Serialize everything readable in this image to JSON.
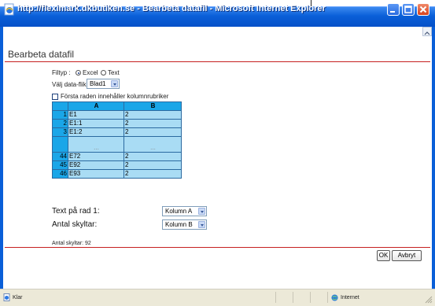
{
  "window": {
    "title": "http://fleximark.dkbutiken.se - Bearbeta datafil - Microsoft Internet Explorer"
  },
  "page": {
    "title": "Bearbeta datafil",
    "filetype_label": "Filtyp :",
    "filetype_options": [
      "Excel",
      "Text"
    ],
    "filetype_selected": "Excel",
    "sheet_label": "Välj data-flik:",
    "sheet_value": "Blad1",
    "first_row_header_label": "Första raden innehåller kolumnrubriker",
    "first_row_header_checked": false
  },
  "table": {
    "columns": [
      "A",
      "B"
    ],
    "rows": [
      {
        "num": "1",
        "a": "E1",
        "b": "2"
      },
      {
        "num": "2",
        "a": "E1:1",
        "b": "2"
      },
      {
        "num": "3",
        "a": "E1:2",
        "b": "2"
      },
      {
        "num": "",
        "a": "...",
        "b": "..."
      },
      {
        "num": "44",
        "a": "E72",
        "b": "2"
      },
      {
        "num": "45",
        "a": "E92",
        "b": "2"
      },
      {
        "num": "46",
        "a": "E93",
        "b": "2"
      }
    ]
  },
  "mapping": {
    "text_label": "Text på rad 1:",
    "text_value": "Kolumn A",
    "count_label": "Antal skyltar:",
    "count_value": "Kolumn B"
  },
  "summary": "Antal skyltar: 92",
  "buttons": {
    "ok": "OK",
    "cancel": "Avbryt"
  },
  "statusbar": {
    "left": "Klar",
    "zone": "Internet"
  },
  "colors": {
    "titlebar": "#0a5fd8",
    "accent_line": "#c62020",
    "table_header": "#1aa6e8",
    "table_cell": "#a9dcf4"
  }
}
